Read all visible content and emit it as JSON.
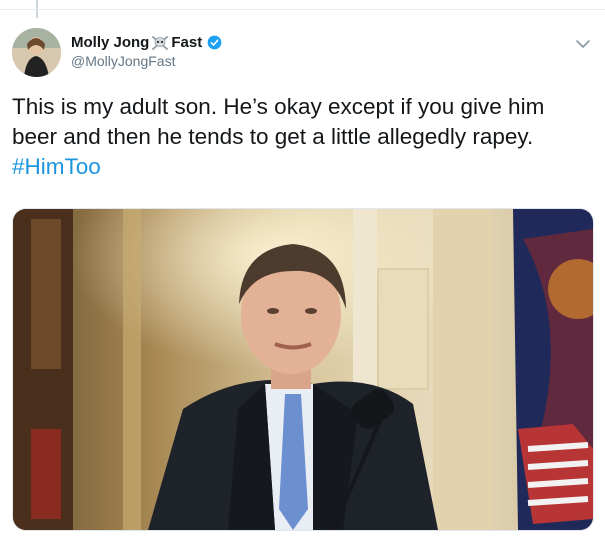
{
  "tweet": {
    "author": {
      "display_name_first": "Molly Jong",
      "display_name_last": "Fast",
      "emoji_icon": "skull-crossbones-icon",
      "verified": true,
      "handle": "@MollyJongFast"
    },
    "text_line": "This is my adult son. He’s okay except if you give him beer and then he tends to get a little allegedly rapey.",
    "hashtag": "#HimToo",
    "menu_icon": "chevron-down-icon"
  },
  "colors": {
    "text": "#14171a",
    "secondary": "#657786",
    "link": "#1b95e0",
    "verified": "#1da1f2"
  }
}
